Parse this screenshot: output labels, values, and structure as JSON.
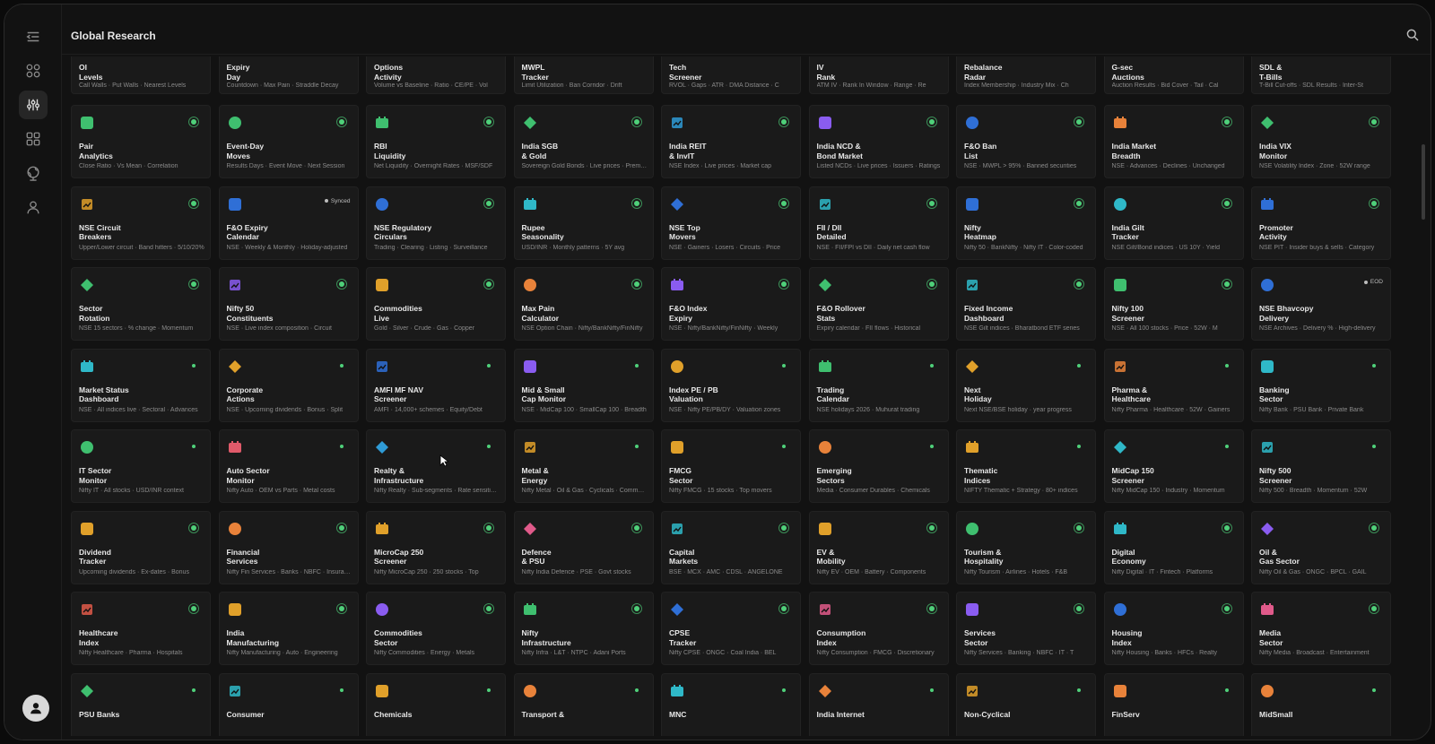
{
  "window": {
    "title": "Global Research"
  },
  "sidebar": {
    "items": [
      {
        "icon": "collapse-menu-icon"
      },
      {
        "icon": "grid-icon"
      },
      {
        "icon": "analytics-icon",
        "active": true
      },
      {
        "icon": "apps-icon"
      },
      {
        "icon": "globe-icon"
      },
      {
        "icon": "user-icon"
      }
    ]
  },
  "status_colors": {
    "ok": "#4fd07a"
  },
  "top_row": [
    {
      "title": "OI\nLevels",
      "sub": "Call Walls · Put Walls · Nearest Levels"
    },
    {
      "title": "Expiry\nDay",
      "sub": "Countdown · Max Pain · Straddle Decay"
    },
    {
      "title": "Options\nActivity",
      "sub": "Volume vs Baseline · Ratio · CE/PE · Vol"
    },
    {
      "title": "MWPL\nTracker",
      "sub": "Limit Utilization · Ban Corridor · Drift"
    },
    {
      "title": "Tech\nScreener",
      "sub": "RVOL · Gaps · ATR · DMA Distance · C"
    },
    {
      "title": "IV\nRank",
      "sub": "ATM IV · Rank In Window · Range · Re"
    },
    {
      "title": "Rebalance\nRadar",
      "sub": "Index Membership · Industry Mix · Ch"
    },
    {
      "title": "G-sec\nAuctions",
      "sub": "Auction Results · Bid Cover · Tail · Cal"
    },
    {
      "title": "SDL &\nT-Bills",
      "sub": "T-Bill Cut-offs · SDL Results · Inter-St"
    }
  ],
  "cards": [
    [
      {
        "title": "Pair\nAnalytics",
        "sub": "Close Ratio · Vs Mean · Correlation",
        "color": "#3fbf6f",
        "status": "ring"
      },
      {
        "title": "Event-Day\nMoves",
        "sub": "Results Days · Event Move · Next Session",
        "color": "#3fbf6f",
        "status": "ring"
      },
      {
        "title": "RBI\nLiquidity",
        "sub": "Net Liquidity · Overnight Rates · MSF/SDF",
        "color": "#3fbf6f",
        "status": "ring"
      },
      {
        "title": "India SGB\n& Gold",
        "sub": "Sovereign Gold Bonds · Live prices · Premium",
        "color": "#3fbf6f",
        "status": "ring"
      },
      {
        "title": "India REIT\n& InvIT",
        "sub": "NSE Index · Live prices · Market cap",
        "color": "#2f9bd6",
        "status": "ring"
      },
      {
        "title": "India NCD &\nBond Market",
        "sub": "Listed NCDs · Live prices · Issuers · Ratings",
        "color": "#8a5cf0",
        "status": "ring"
      },
      {
        "title": "F&O Ban\nList",
        "sub": "NSE · MWPL > 95% · Banned securities",
        "color": "#2f6fd6",
        "status": "ring"
      },
      {
        "title": "India Market\nBreadth",
        "sub": "NSE · Advances · Declines · Unchanged",
        "color": "#e8823a",
        "status": "ring"
      },
      {
        "title": "India VIX\nMonitor",
        "sub": "NSE Volatility Index · Zone · 52W range",
        "color": "#3fbf6f",
        "status": "ring"
      }
    ],
    [
      {
        "title": "NSE Circuit\nBreakers",
        "sub": "Upper/Lower circuit · Band hitters · 5/10/20%",
        "color": "#e0a02a",
        "status": "ring"
      },
      {
        "title": "F&O Expiry\nCalendar",
        "sub": "NSE · Weekly & Monthly · Holiday-adjusted",
        "color": "#2f6fd6",
        "status": "synced",
        "badge": "Synced"
      },
      {
        "title": "NSE Regulatory\nCirculars",
        "sub": "Trading · Clearing · Listing · Surveillance",
        "color": "#2f6fd6",
        "status": "ring"
      },
      {
        "title": "Rupee\nSeasonality",
        "sub": "USD/INR · Monthly patterns · 5Y avg",
        "color": "#2fb8c8",
        "status": "ring"
      },
      {
        "title": "NSE Top\nMovers",
        "sub": "NSE · Gainers · Losers · Circuits · Price",
        "color": "#2f6fd6",
        "status": "ring"
      },
      {
        "title": "FII / DII\nDetailed",
        "sub": "NSE · FII/FPI vs DII · Daily net cash flow",
        "color": "#2fb8c8",
        "status": "ring"
      },
      {
        "title": "Nifty\nHeatmap",
        "sub": "Nifty 50 · BankNifty · Nifty IT · Color-coded",
        "color": "#2f6fd6",
        "status": "ring"
      },
      {
        "title": "India Gilt\nTracker",
        "sub": "NSE Gilt/Bond indices · US 10Y · Yield",
        "color": "#2fb8c8",
        "status": "ring"
      },
      {
        "title": "Promoter\nActivity",
        "sub": "NSE PIT · Insider buys & sells · Category",
        "color": "#2f6fd6",
        "status": "ring"
      }
    ],
    [
      {
        "title": "Sector\nRotation",
        "sub": "NSE 15 sectors · % change · Momentum",
        "color": "#3fbf6f",
        "status": "ring"
      },
      {
        "title": "Nifty 50\nConstituents",
        "sub": "NSE · Live index composition · Circuit",
        "color": "#8a5cf0",
        "status": "ring"
      },
      {
        "title": "Commodities\nLive",
        "sub": "Gold · Silver · Crude · Gas · Copper",
        "color": "#e0a02a",
        "status": "ring"
      },
      {
        "title": "Max Pain\nCalculator",
        "sub": "NSE Option Chain · Nifty/BankNifty/FinNifty",
        "color": "#e8823a",
        "status": "ring"
      },
      {
        "title": "F&O Index\nExpiry",
        "sub": "NSE · Nifty/BankNifty/FinNifty · Weekly",
        "color": "#8a5cf0",
        "status": "ring"
      },
      {
        "title": "F&O Rollover\nStats",
        "sub": "Expiry calendar · FII flows · Historical",
        "color": "#3fbf6f",
        "status": "ring"
      },
      {
        "title": "Fixed Income\nDashboard",
        "sub": "NSE Gilt indices · Bharatbond ETF series",
        "color": "#2fb8c8",
        "status": "ring"
      },
      {
        "title": "Nifty 100\nScreener",
        "sub": "NSE · All 100 stocks · Price · 52W · M",
        "color": "#3fbf6f",
        "status": "ring"
      },
      {
        "title": "NSE Bhavcopy\nDelivery",
        "sub": "NSE Archives · Delivery % · High-delivery",
        "color": "#2f6fd6",
        "status": "eod",
        "badge": "EOD"
      }
    ],
    [
      {
        "title": "Market Status\nDashboard",
        "sub": "NSE · All indices live · Sectoral · Advances",
        "color": "#2fb8c8",
        "status": "dot"
      },
      {
        "title": "Corporate\nActions",
        "sub": "NSE · Upcoming dividends · Bonus · Split",
        "color": "#e0a02a",
        "status": "dot"
      },
      {
        "title": "AMFI MF NAV\nScreener",
        "sub": "AMFI · 14,000+ schemes · Equity/Debt",
        "color": "#2f6fd6",
        "status": "dot"
      },
      {
        "title": "Mid & Small\nCap Monitor",
        "sub": "NSE · MidCap 100 · SmallCap 100 · Breadth",
        "color": "#8a5cf0",
        "status": "dot"
      },
      {
        "title": "Index PE / PB\nValuation",
        "sub": "NSE · Nifty PE/PB/DY · Valuation zones",
        "color": "#e0a02a",
        "status": "dot"
      },
      {
        "title": "Trading\nCalendar",
        "sub": "NSE holidays 2026 · Muhurat trading",
        "color": "#3fbf6f",
        "status": "dot"
      },
      {
        "title": "Next\nHoliday",
        "sub": "Next NSE/BSE holiday · year progress",
        "color": "#e0a02a",
        "status": "dot"
      },
      {
        "title": "Pharma &\nHealthcare",
        "sub": "Nifty Pharma · Healthcare · 52W · Gainers",
        "color": "#e8823a",
        "status": "dot"
      },
      {
        "title": "Banking\nSector",
        "sub": "Nifty Bank · PSU Bank · Private Bank",
        "color": "#2fb8c8",
        "status": "dot"
      }
    ],
    [
      {
        "title": "IT Sector\nMonitor",
        "sub": "Nifty IT · All stocks · USD/INR context",
        "color": "#3fbf6f",
        "status": "dot"
      },
      {
        "title": "Auto Sector\nMonitor",
        "sub": "Nifty Auto · OEM vs Parts · Metal costs",
        "color": "#e05a6a",
        "status": "dot"
      },
      {
        "title": "Realty &\nInfrastructure",
        "sub": "Nifty Realty · Sub-segments · Rate sensitivity",
        "color": "#2f9bd6",
        "status": "dot"
      },
      {
        "title": "Metal &\nEnergy",
        "sub": "Nifty Metal · Oil & Gas · Cyclicals · Commodities",
        "color": "#e0a02a",
        "status": "dot"
      },
      {
        "title": "FMCG\nSector",
        "sub": "Nifty FMCG · 15 stocks · Top movers",
        "color": "#e0a02a",
        "status": "dot"
      },
      {
        "title": "Emerging\nSectors",
        "sub": "Media · Consumer Durables · Chemicals",
        "color": "#e8823a",
        "status": "dot"
      },
      {
        "title": "Thematic\nIndices",
        "sub": "NIFTY Thematic + Strategy · 80+ indices",
        "color": "#e0a02a",
        "status": "dot"
      },
      {
        "title": "MidCap 150\nScreener",
        "sub": "Nifty MidCap 150 · Industry · Momentum",
        "color": "#2fb8c8",
        "status": "dot"
      },
      {
        "title": "Nifty 500\nScreener",
        "sub": "Nifty 500 · Breadth · Momentum · 52W",
        "color": "#2fb8c8",
        "status": "dot"
      }
    ],
    [
      {
        "title": "Dividend\nTracker",
        "sub": "Upcoming dividends · Ex-dates · Bonus",
        "color": "#e0a02a",
        "status": "ring"
      },
      {
        "title": "Financial\nServices",
        "sub": "Nifty Fin Services · Banks · NBFC · Insurance",
        "color": "#e8823a",
        "status": "ring"
      },
      {
        "title": "MicroCap 250\nScreener",
        "sub": "Nifty MicroCap 250 · 250 stocks · Top",
        "color": "#e0a02a",
        "status": "ring"
      },
      {
        "title": "Defence\n& PSU",
        "sub": "Nifty India Defence · PSE · Govt stocks",
        "color": "#e05a8a",
        "status": "ring"
      },
      {
        "title": "Capital\nMarkets",
        "sub": "BSE · MCX · AMC · CDSL · ANGELONE",
        "color": "#2fb8c8",
        "status": "ring"
      },
      {
        "title": "EV &\nMobility",
        "sub": "Nifty EV · OEM · Battery · Components",
        "color": "#e0a02a",
        "status": "ring"
      },
      {
        "title": "Tourism &\nHospitality",
        "sub": "Nifty Tourism · Airlines · Hotels · F&B",
        "color": "#3fbf6f",
        "status": "ring"
      },
      {
        "title": "Digital\nEconomy",
        "sub": "Nifty Digital · IT · Fintech · Platforms",
        "color": "#2fb8c8",
        "status": "ring"
      },
      {
        "title": "Oil &\nGas Sector",
        "sub": "Nifty Oil & Gas · ONGC · BPCL · GAIL",
        "color": "#8a5cf0",
        "status": "ring"
      }
    ],
    [
      {
        "title": "Healthcare\nIndex",
        "sub": "Nifty Healthcare · Pharma · Hospitals",
        "color": "#e05a4a",
        "status": "ring"
      },
      {
        "title": "India\nManufacturing",
        "sub": "Nifty Manufacturing · Auto · Engineering",
        "color": "#e0a02a",
        "status": "ring"
      },
      {
        "title": "Commodities\nSector",
        "sub": "Nifty Commodities · Energy · Metals",
        "color": "#8a5cf0",
        "status": "ring"
      },
      {
        "title": "Nifty\nInfrastructure",
        "sub": "Nifty Infra · L&T · NTPC · Adani Ports",
        "color": "#3fbf6f",
        "status": "ring"
      },
      {
        "title": "CPSE\nTracker",
        "sub": "Nifty CPSE · ONGC · Coal India · BEL",
        "color": "#2f6fd6",
        "status": "ring"
      },
      {
        "title": "Consumption\nIndex",
        "sub": "Nifty Consumption · FMCG · Discretionary",
        "color": "#e05a8a",
        "status": "ring"
      },
      {
        "title": "Services\nSector",
        "sub": "Nifty Services · Banking · NBFC · IT · T",
        "color": "#8a5cf0",
        "status": "ring"
      },
      {
        "title": "Housing\nIndex",
        "sub": "Nifty Housing · Banks · HFCs · Realty",
        "color": "#2f6fd6",
        "status": "ring"
      },
      {
        "title": "Media\nSector",
        "sub": "Nifty Media · Broadcast · Entertainment",
        "color": "#e05a8a",
        "status": "ring"
      }
    ],
    [
      {
        "title": "PSU Banks",
        "sub": "",
        "color": "#3fbf6f",
        "status": "dot"
      },
      {
        "title": "Consumer",
        "sub": "",
        "color": "#2fb8c8",
        "status": "dot"
      },
      {
        "title": "Chemicals",
        "sub": "",
        "color": "#e0a02a",
        "status": "dot"
      },
      {
        "title": "Transport &",
        "sub": "",
        "color": "#e8823a",
        "status": "dot"
      },
      {
        "title": "MNC",
        "sub": "",
        "color": "#2fb8c8",
        "status": "dot"
      },
      {
        "title": "India Internet",
        "sub": "",
        "color": "#e8823a",
        "status": "dot"
      },
      {
        "title": "Non-Cyclical",
        "sub": "",
        "color": "#e0a02a",
        "status": "dot"
      },
      {
        "title": "FinServ",
        "sub": "",
        "color": "#e8823a",
        "status": "dot"
      },
      {
        "title": "MidSmall",
        "sub": "",
        "color": "#e8823a",
        "status": "dot"
      }
    ]
  ]
}
